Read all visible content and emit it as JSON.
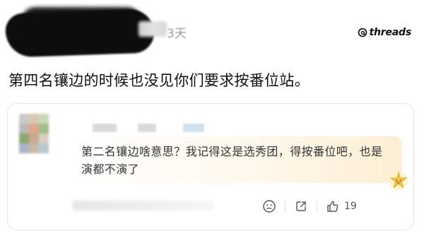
{
  "post": {
    "time_label": "3天",
    "text": "第四名镶边的时候也没见你们要求按番位站。"
  },
  "brand": {
    "name": "threads"
  },
  "quoted_comment": {
    "text": "第二名镶边啥意思？我记得这是选秀团，得按番位吧，也是演都不演了",
    "like_count": "19"
  },
  "icons": {
    "threads": "threads-logo-icon",
    "emoji": "emoji-icon",
    "share": "share-icon",
    "like": "thumbs-up-icon",
    "sticker": "sticker-icon"
  },
  "colors": {
    "bubble_accent": "#fdeed4",
    "text_primary": "#111111",
    "text_secondary": "#9a9a9a"
  }
}
